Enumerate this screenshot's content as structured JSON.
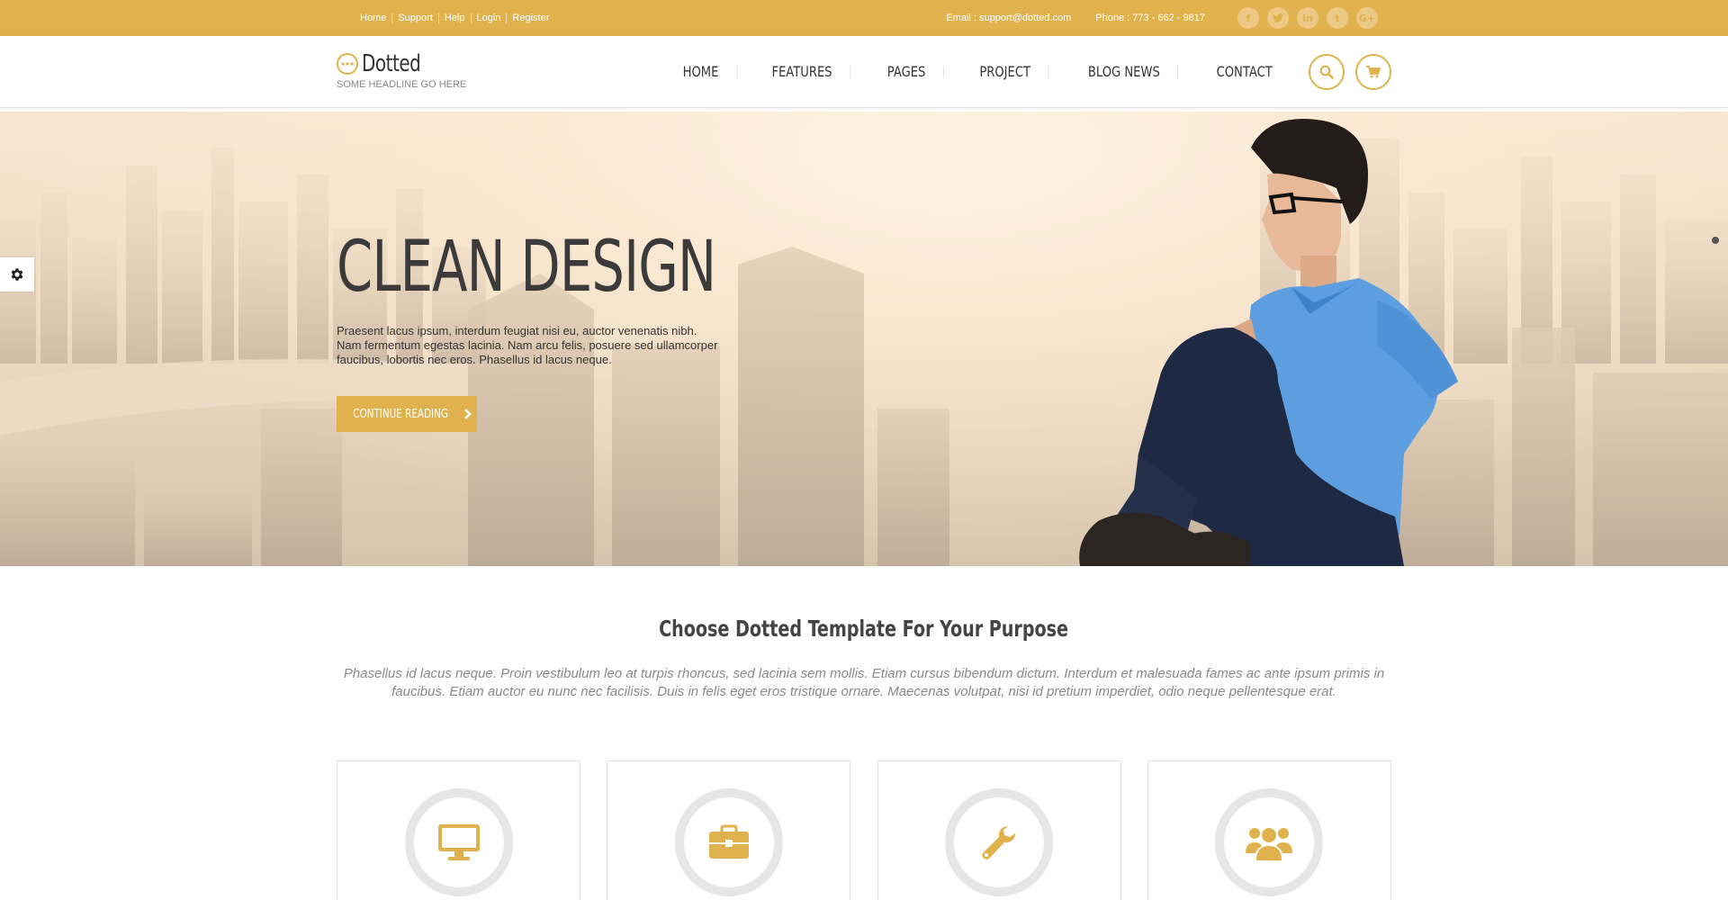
{
  "topbar": {
    "links": [
      "Home",
      "Support",
      "Help",
      "Login",
      "Register"
    ],
    "email": "Email : support@dotted.com",
    "phone": "Phone : 773 - 662 - 9817",
    "socials": [
      "f",
      "t",
      "in",
      "t",
      "G+"
    ]
  },
  "header": {
    "logo_name": "Dotted",
    "logo_tagline": "SOME HEADLINE GO HERE",
    "nav": [
      "HOME",
      "FEATURES",
      "PAGES",
      "PROJECT",
      "BLOG NEWS",
      "CONTACT"
    ]
  },
  "hero": {
    "title": "CLEAN DESIGN",
    "text": "Praesent lacus ipsum, interdum feugiat nisi eu, auctor venenatis nibh. Nam fermentum egestas lacinia. Nam arcu felis, posuere sed ullamcorper faucibus, lobortis nec eros. Phasellus id lacus neque.",
    "button": "CONTINUE READING"
  },
  "purpose": {
    "title": "Choose Dotted Template For Your Purpose",
    "text": "Phasellus id lacus neque. Proin vestibulum leo at turpis rhoncus, sed lacinia sem mollis. Etiam cursus bibendum dictum. Interdum et malesuada fames ac ante ipsum primis in faucibus. Etiam auctor eu nunc nec facilisis. Duis in felis eget eros tristique ornare. Maecenas volutpat, nisi id pretium imperdiet, odio neque pellentesque erat."
  },
  "colors": {
    "accent": "#e0b24e",
    "text": "#333333",
    "muted": "#8a8a8a"
  },
  "icons": [
    "monitor-icon",
    "briefcase-icon",
    "wrench-icon",
    "users-icon",
    "search-icon",
    "cart-icon",
    "gear-icon"
  ]
}
